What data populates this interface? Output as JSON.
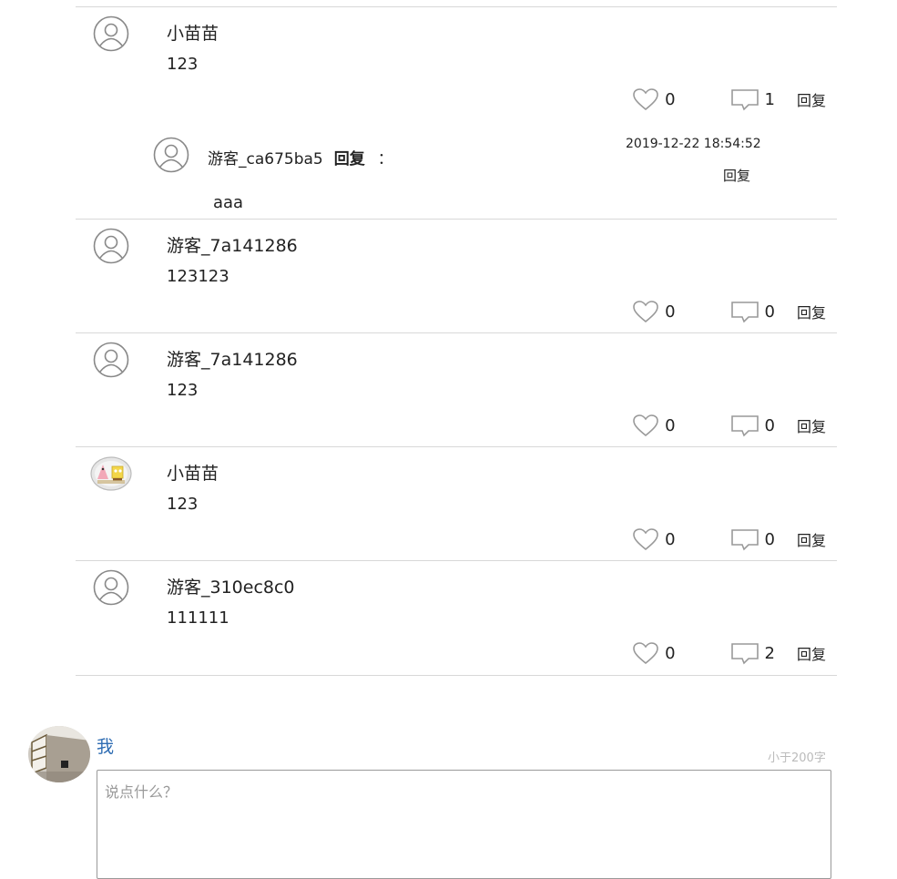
{
  "comments": [
    {
      "name": "小苗苗",
      "text": "123",
      "likes": "0",
      "replies": "1",
      "reply_label": "回复",
      "avatar": "default-user-icon"
    },
    {
      "name": "游客_7a141286",
      "text": "123123",
      "likes": "0",
      "replies": "0",
      "reply_label": "回复",
      "avatar": "default-user-icon"
    },
    {
      "name": "游客_7a141286",
      "text": "123",
      "likes": "0",
      "replies": "0",
      "reply_label": "回复",
      "avatar": "default-user-icon"
    },
    {
      "name": "小苗苗",
      "text": "123",
      "likes": "0",
      "replies": "0",
      "reply_label": "回复",
      "avatar": "cartoon-avatar"
    },
    {
      "name": "游客_310ec8c0",
      "text": "111111",
      "likes": "0",
      "replies": "2",
      "reply_label": "回复",
      "avatar": "default-user-icon"
    }
  ],
  "sub_reply": {
    "name": "游客_ca675ba5",
    "action": "回复",
    "colon": "：",
    "time": "2019-12-22 18:54:52",
    "reply_label": "回复",
    "text": "aaa"
  },
  "composer": {
    "user": "我",
    "limit": "小于200字",
    "placeholder": "说点什么？"
  },
  "colors": {
    "link": "#2f6db3",
    "divider": "#d8d8d8",
    "icon": "#888888"
  }
}
